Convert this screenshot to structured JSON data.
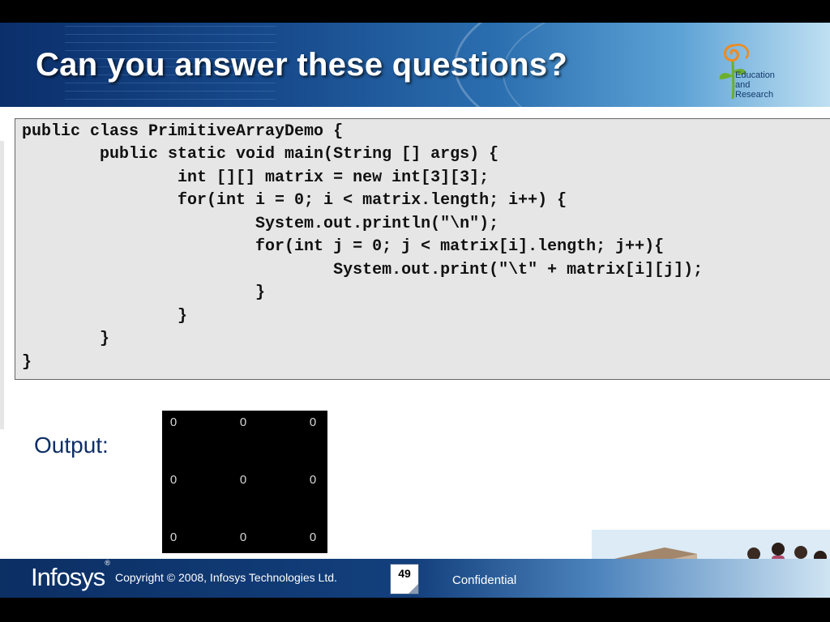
{
  "slide": {
    "title": "Can you answer these questions?"
  },
  "logo": {
    "line1": "Education",
    "line2": "and",
    "line3": "Research",
    "icon": "flower-logo-icon"
  },
  "code": {
    "lines": [
      "public class PrimitiveArrayDemo {",
      "        public static void main(String [] args) {",
      "                int [][] matrix = new int[3][3];",
      "                for(int i = 0; i < matrix.length; i++) {",
      "                        System.out.println(\"\\n\");",
      "                        for(int j = 0; j < matrix[i].length; j++){",
      "                                System.out.print(\"\\t\" + matrix[i][j]);",
      "                        }",
      "                }",
      "        }",
      "}"
    ]
  },
  "output": {
    "label": "Output:",
    "console": [
      [
        "0",
        "0",
        "0"
      ],
      [
        "0",
        "0",
        "0"
      ],
      [
        "0",
        "0",
        "0"
      ]
    ]
  },
  "footer": {
    "brand": "Infosys",
    "registered": "®",
    "copyright": "Copyright © 2008, Infosys Technologies Ltd.",
    "page_number": "49",
    "confidential": "Confidential"
  },
  "colors": {
    "title_banner": "#184c8e",
    "output_label": "#0f2f66",
    "code_bg": "#e6e6e6",
    "logo_orange": "#f08a1c",
    "logo_green": "#6cae2e"
  }
}
